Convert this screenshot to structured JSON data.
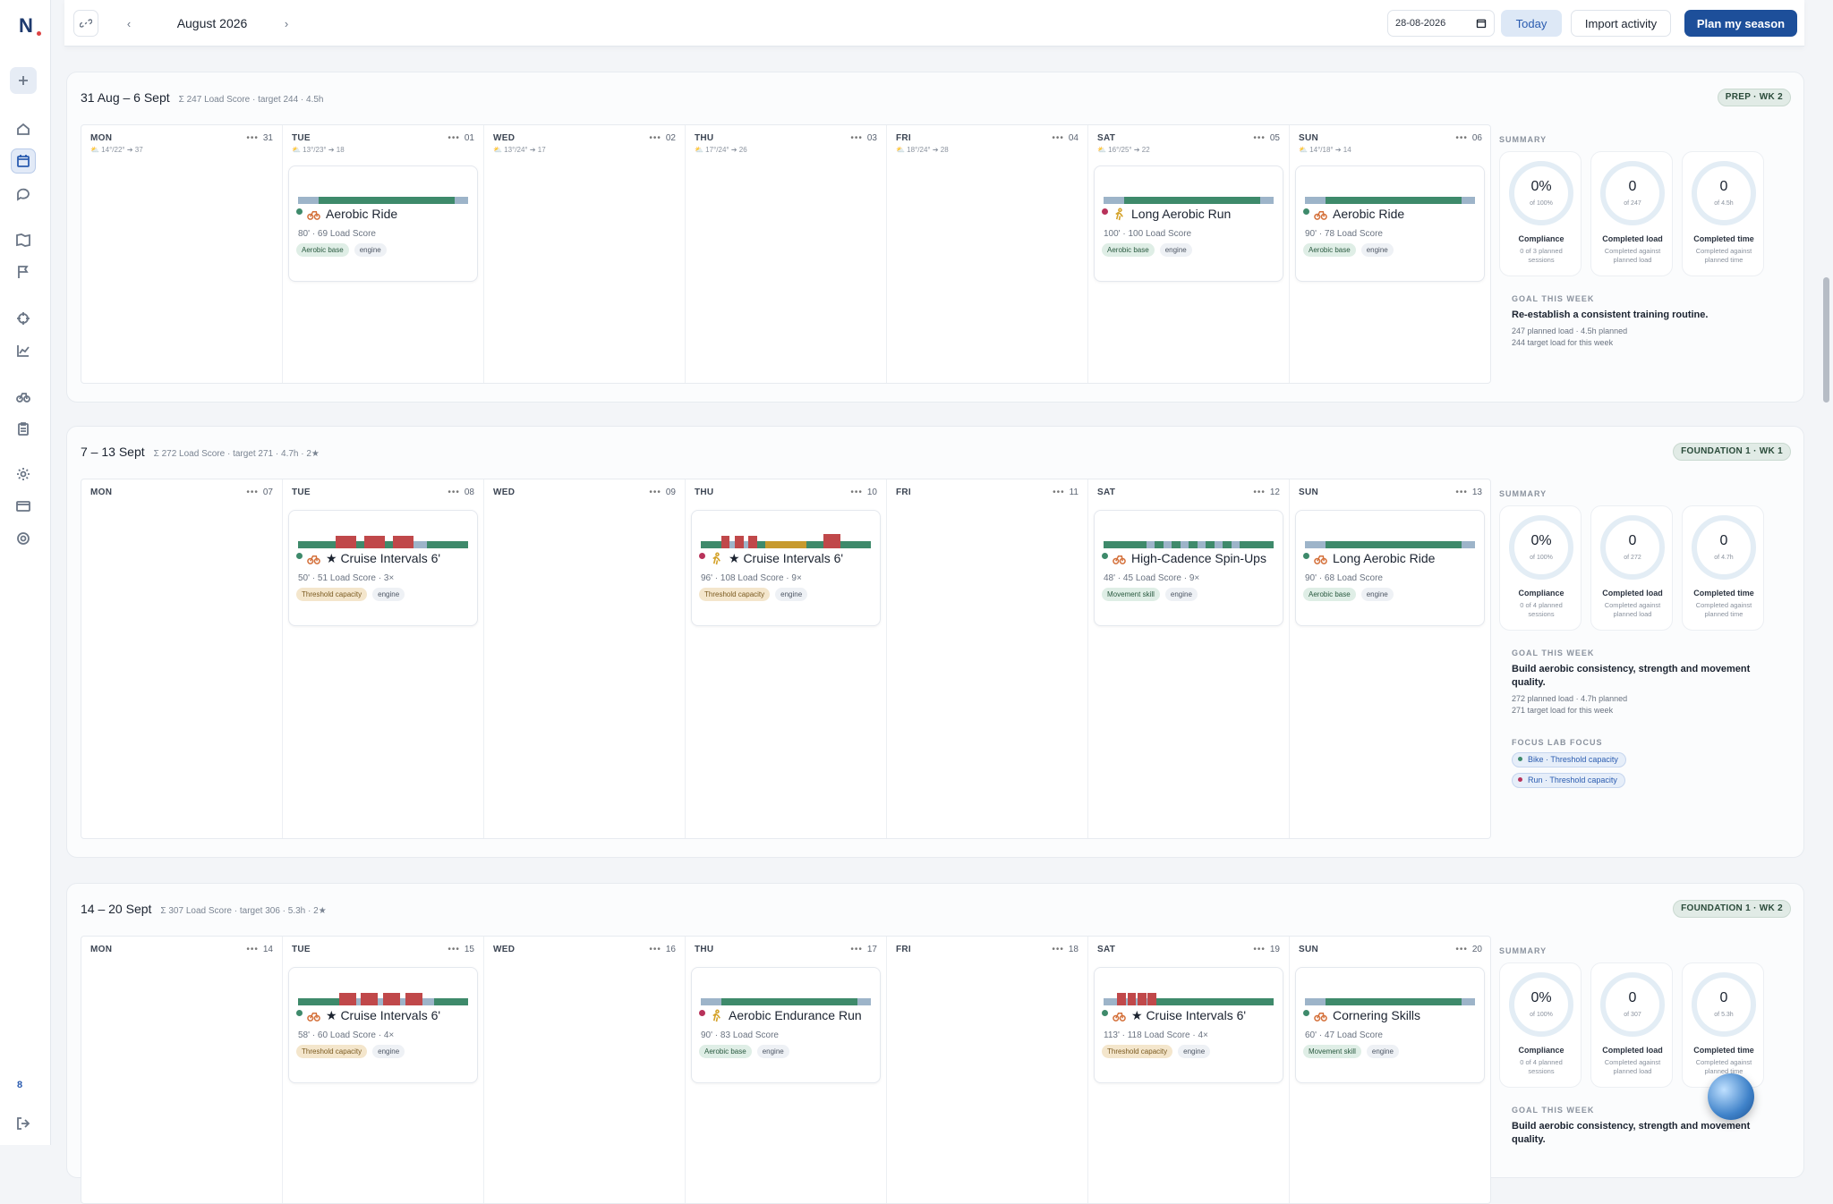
{
  "app": {
    "logo": "N",
    "rail_badge": "8"
  },
  "topbar": {
    "month": "August 2026",
    "prev": "‹",
    "next": "›",
    "date_value": "28-08-2026",
    "today": "Today",
    "import": "Import activity",
    "plan": "Plan my season"
  },
  "colors": {
    "green": "#3e8a6b",
    "light_blue": "#9db4c9",
    "red": "#c0484a",
    "gold": "#c79a2e",
    "accent": "#1d4f9a"
  },
  "summary_labels": {
    "section": "SUMMARY",
    "compliance": "Compliance",
    "completed_load": "Completed load",
    "completed_time": "Completed time",
    "load_sub": "Completed against planned load",
    "time_sub": "Completed against planned time",
    "goal_heading": "GOAL THIS WEEK",
    "focus_heading": "FOCUS LAB FOCUS"
  },
  "weeks": [
    {
      "title": "31 Aug – 6 Sept",
      "sub": "Σ 247 Load Score · target 244 · 4.5h",
      "phase": "PREP · WK 2",
      "days": [
        {
          "name": "MON",
          "num": "31",
          "weather": "⛅ 14°/22° ➔ 37"
        },
        {
          "name": "TUE",
          "num": "01",
          "weather": "⛅ 13°/23° ➔ 18"
        },
        {
          "name": "WED",
          "num": "02",
          "weather": "⛅ 13°/24° ➔ 17"
        },
        {
          "name": "THU",
          "num": "03",
          "weather": "⛅ 17°/24° ➔ 26"
        },
        {
          "name": "FRI",
          "num": "04",
          "weather": "⛅ 18°/24° ➔ 28"
        },
        {
          "name": "SAT",
          "num": "05",
          "weather": "⛅ 16°/25° ➔ 22"
        },
        {
          "name": "SUN",
          "num": "06",
          "weather": "⛅ 14°/18° ➔ 14"
        }
      ],
      "sessions": [
        {
          "day": 1,
          "sport": "bike",
          "title": "Aerobic Ride",
          "meta": "80' · 69 Load Score",
          "zone": "Aerobic base",
          "tag2": "engine",
          "pattern": "aerobic"
        },
        {
          "day": 5,
          "sport": "run",
          "title": "Long Aerobic Run",
          "meta": "100' · 100 Load Score",
          "zone": "Aerobic base",
          "tag2": "engine",
          "pattern": "aerobic"
        },
        {
          "day": 6,
          "sport": "bike",
          "title": "Aerobic Ride",
          "meta": "90' · 78 Load Score",
          "zone": "Aerobic base",
          "tag2": "engine",
          "pattern": "aerobic"
        }
      ],
      "summary": {
        "compliance": "0%",
        "compliance_of": "of 100%",
        "compliance_sub": "0 of 3 planned sessions",
        "load": "0",
        "load_of": "of 247",
        "time": "0",
        "time_of": "of 4.5h"
      },
      "goal": {
        "text": "Re-establish a consistent training routine.",
        "line1": "247 planned load · 4.5h planned",
        "line2": "244 target load for this week"
      }
    },
    {
      "title": "7 – 13 Sept",
      "sub": "Σ 272 Load Score · target 271 · 4.7h · 2★",
      "phase": "FOUNDATION 1 · WK 1",
      "days": [
        {
          "name": "MON",
          "num": "07"
        },
        {
          "name": "TUE",
          "num": "08"
        },
        {
          "name": "WED",
          "num": "09"
        },
        {
          "name": "THU",
          "num": "10"
        },
        {
          "name": "FRI",
          "num": "11"
        },
        {
          "name": "SAT",
          "num": "12"
        },
        {
          "name": "SUN",
          "num": "13"
        }
      ],
      "sessions": [
        {
          "day": 1,
          "sport": "bike",
          "title": "★ Cruise Intervals 6'",
          "meta": "50' · 51 Load Score · 3×",
          "zone": "Threshold capacity",
          "tag2": "engine",
          "pattern": "cruise3"
        },
        {
          "day": 3,
          "sport": "run",
          "title": "★ Cruise Intervals 6'",
          "meta": "96' · 108 Load Score · 9×",
          "zone": "Threshold capacity",
          "tag2": "engine",
          "pattern": "cruiserun"
        },
        {
          "day": 5,
          "sport": "bike",
          "title": "High-Cadence Spin-Ups",
          "meta": "48' · 45 Load Score · 9×",
          "zone": "Movement skill",
          "tag2": "engine",
          "pattern": "spin"
        },
        {
          "day": 6,
          "sport": "bike",
          "title": "Long Aerobic Ride",
          "meta": "90' · 68 Load Score",
          "zone": "Aerobic base",
          "tag2": "engine",
          "pattern": "aerobic"
        }
      ],
      "summary": {
        "compliance": "0%",
        "compliance_of": "of 100%",
        "compliance_sub": "0 of 4 planned sessions",
        "load": "0",
        "load_of": "of 272",
        "time": "0",
        "time_of": "of 4.7h"
      },
      "goal": {
        "text": "Build aerobic consistency, strength and movement quality.",
        "line1": "272 planned load · 4.7h planned",
        "line2": "271 target load for this week"
      },
      "focus": [
        "Bike · Threshold capacity",
        "Run · Threshold capacity"
      ]
    },
    {
      "title": "14 – 20 Sept",
      "sub": "Σ 307 Load Score · target 306 · 5.3h · 2★",
      "phase": "FOUNDATION 1 · WK 2",
      "days": [
        {
          "name": "MON",
          "num": "14"
        },
        {
          "name": "TUE",
          "num": "15"
        },
        {
          "name": "WED",
          "num": "16"
        },
        {
          "name": "THU",
          "num": "17"
        },
        {
          "name": "FRI",
          "num": "18"
        },
        {
          "name": "SAT",
          "num": "19"
        },
        {
          "name": "SUN",
          "num": "20"
        }
      ],
      "sessions": [
        {
          "day": 1,
          "sport": "bike",
          "title": "★ Cruise Intervals 6'",
          "meta": "58' · 60 Load Score · 4×",
          "zone": "Threshold capacity",
          "tag2": "engine",
          "pattern": "cruise4"
        },
        {
          "day": 3,
          "sport": "run",
          "title": "Aerobic Endurance Run",
          "meta": "90' · 83 Load Score",
          "zone": "Aerobic base",
          "tag2": "engine",
          "pattern": "aerobic"
        },
        {
          "day": 5,
          "sport": "bike",
          "title": "★ Cruise Intervals 6'",
          "meta": "113' · 118 Load Score · 4×",
          "zone": "Threshold capacity",
          "tag2": "engine",
          "pattern": "cruise4b"
        },
        {
          "day": 6,
          "sport": "bike",
          "title": "Cornering Skills",
          "meta": "60' · 47 Load Score",
          "zone": "Movement skill",
          "tag2": "engine",
          "pattern": "aerobic"
        }
      ],
      "summary": {
        "compliance": "0%",
        "compliance_of": "of 100%",
        "compliance_sub": "0 of 4 planned sessions",
        "load": "0",
        "load_of": "of 307",
        "time": "0",
        "time_of": "of 5.3h"
      },
      "goal": {
        "text": "Build aerobic consistency, strength and movement quality.",
        "line1": "",
        "line2": ""
      }
    }
  ]
}
